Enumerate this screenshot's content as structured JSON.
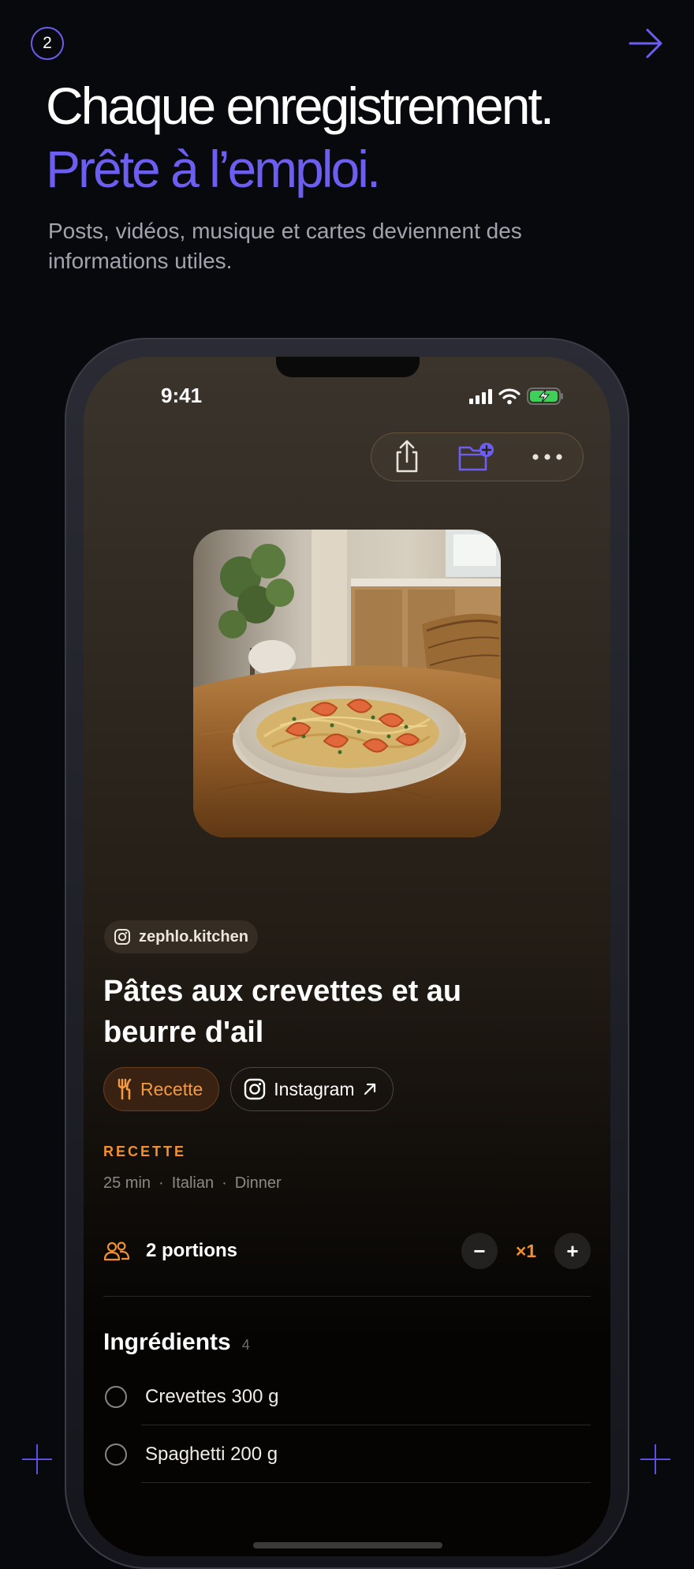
{
  "onboarding": {
    "step_number": "2",
    "headline_line1": "Chaque enregistrement.",
    "headline_line2": "Prête à l’emploi.",
    "subtitle": "Posts, vidéos, musique et cartes deviennent des informations utiles.",
    "next_icon": "arrow-right-icon",
    "accent_color": "#6c5ef0"
  },
  "status_bar": {
    "time": "9:41",
    "icons": [
      "signal-icon",
      "wifi-icon",
      "battery-charging-icon"
    ]
  },
  "toolbar": {
    "buttons": [
      "share-icon",
      "add-to-folder-icon",
      "more-icon"
    ]
  },
  "recipe": {
    "image_alt": "Pâtes aux crevettes dans un bol blanc sur une table en bois",
    "source_handle": "zephlo.kitchen",
    "title": "Pâtes aux crevettes et au beurre d'ail",
    "tags": {
      "category": "Recette",
      "platform": "Instagram"
    },
    "section_label": "RECETTE",
    "meta": {
      "time": "25 min",
      "cuisine": "Italian",
      "meal": "Dinner",
      "separator": "·"
    },
    "portions": {
      "label": "2 portions",
      "multiplier": "×1",
      "decrement": "−",
      "increment": "+"
    },
    "ingredients": {
      "heading": "Ingrédients",
      "count": "4",
      "items": [
        {
          "label": "Crevettes 300 g",
          "checked": false
        },
        {
          "label": "Spaghetti 200 g",
          "checked": false
        }
      ]
    },
    "accent_color": "#f09030"
  }
}
